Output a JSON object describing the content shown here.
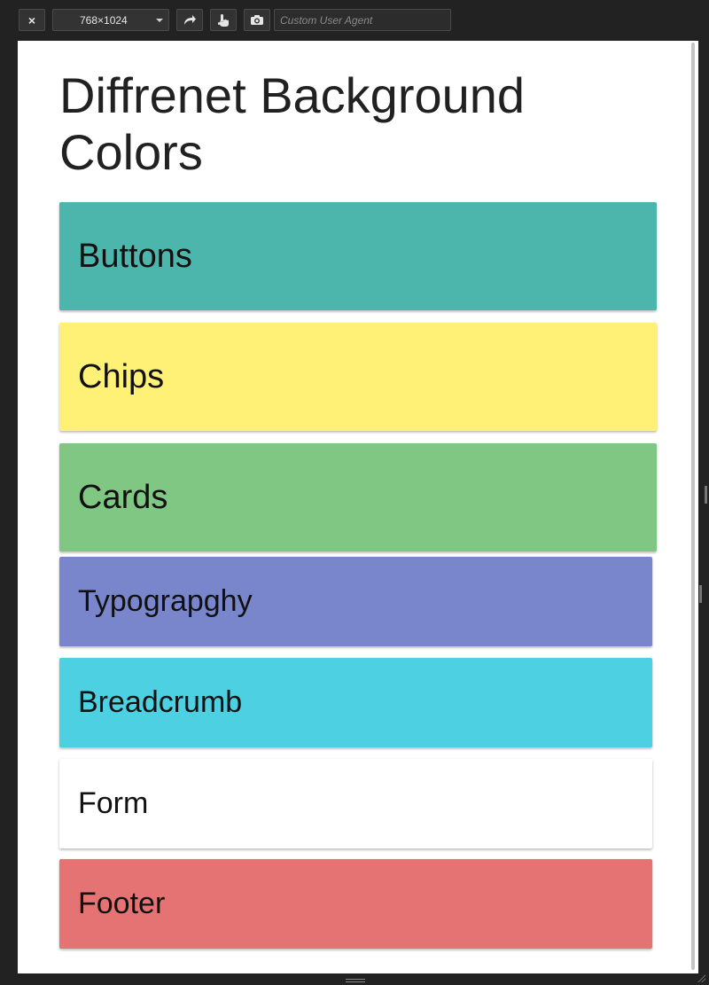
{
  "toolbar": {
    "close_label": "×",
    "size_label": "768×1024",
    "rotate_icon": "↷",
    "touch_icon": "☝",
    "screenshot_icon": "📷",
    "user_agent_placeholder": "Custom User Agent"
  },
  "page": {
    "title": "Diffrenet Background Colors"
  },
  "panels": [
    {
      "label": "Buttons",
      "color": "#4db6ac"
    },
    {
      "label": "Chips",
      "color": "#fff176"
    },
    {
      "label": "Cards",
      "color": "#81c784"
    },
    {
      "label": "Typograpghy",
      "color": "#7986cb"
    },
    {
      "label": "Breadcrumb",
      "color": "#4dd0e1"
    },
    {
      "label": "Form",
      "color": "#ffffff"
    },
    {
      "label": "Footer",
      "color": "#e57373"
    }
  ]
}
